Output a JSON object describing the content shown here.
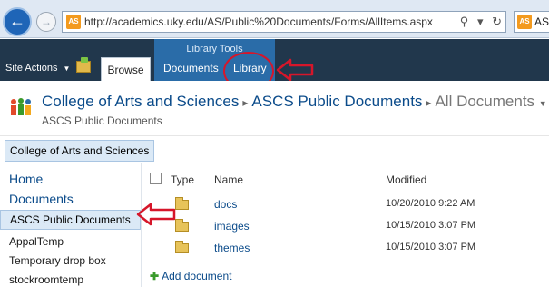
{
  "browser": {
    "url": "http://academics.uky.edu/AS/Public%20Documents/Forms/AllItems.aspx",
    "site_icon_text": "AS",
    "tab_title": "AS"
  },
  "ribbon": {
    "site_actions": "Site Actions",
    "browse_tab": "Browse",
    "group_label": "Library Tools",
    "documents_tab": "Documents",
    "library_tab": "Library"
  },
  "title": {
    "site": "College of Arts and Sciences",
    "library": "ASCS Public Documents",
    "view": "All Documents",
    "subtitle": "ASCS Public Documents"
  },
  "topnav": {
    "item": "College of Arts and Sciences"
  },
  "quicklaunch": {
    "home": "Home",
    "documents": "Documents",
    "items": [
      "ASCS Public Documents",
      "AppalTemp",
      "Temporary drop box",
      "stockroomtemp"
    ]
  },
  "list": {
    "columns": {
      "type": "Type",
      "name": "Name",
      "modified": "Modified"
    },
    "rows": [
      {
        "name": "docs",
        "modified": "10/20/2010 9:22 AM"
      },
      {
        "name": "images",
        "modified": "10/15/2010 3:07 PM"
      },
      {
        "name": "themes",
        "modified": "10/15/2010 3:07 PM"
      }
    ],
    "add_document": "Add document"
  },
  "colors": {
    "annotation": "#d6162a",
    "ribbon_dark": "#21374c",
    "ribbon_context": "#2a6ca8",
    "link": "#0b4b8a"
  }
}
